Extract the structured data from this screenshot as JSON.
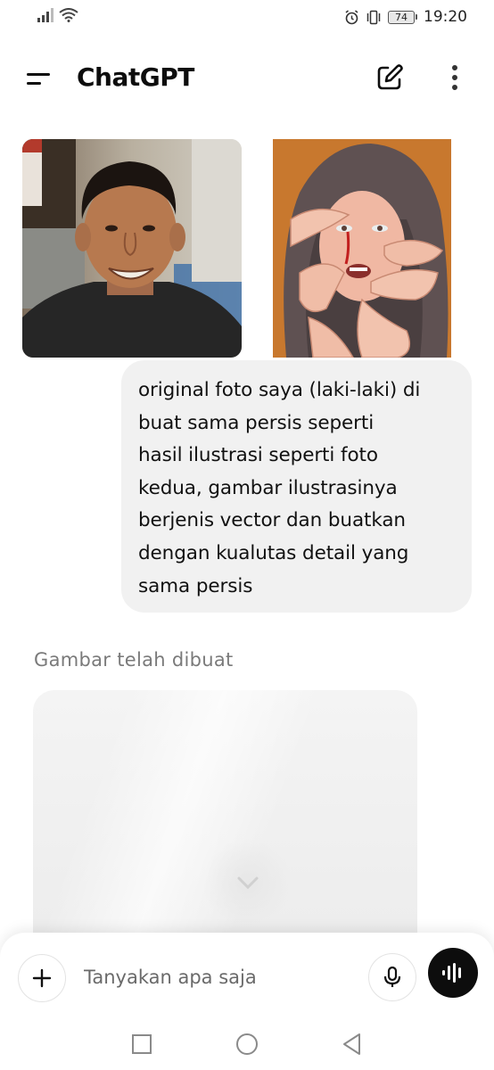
{
  "status_bar": {
    "battery_level": "74",
    "time": "19:20"
  },
  "header": {
    "title": "ChatGPT",
    "icons": [
      "menu-icon",
      "new-chat-icon",
      "more-vertical-icon"
    ]
  },
  "conversation": {
    "user_images": [
      {
        "description": "user-selfie-photo"
      },
      {
        "description": "vector-illustration-reference"
      }
    ],
    "user_message": "original foto saya (laki-laki) di\nbuat sama persis seperti\nhasil ilustrasi seperti foto\nkedua, gambar ilustrasinya\nberjenis vector dan buatkan\ndengan kualutas detail yang\nsama persis",
    "assistant_status": "Gambar telah dibuat"
  },
  "composer": {
    "placeholder": "Tanyakan apa saja",
    "value": ""
  },
  "colors": {
    "bubble_bg": "#f1f1f1",
    "voice_button_bg": "#0d0d0d",
    "illustration_bg": "#c8782e"
  }
}
